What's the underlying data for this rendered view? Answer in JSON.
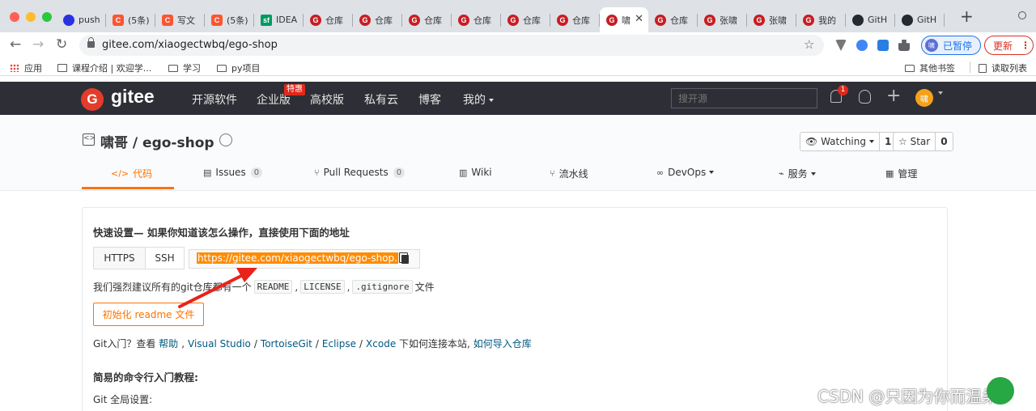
{
  "browser": {
    "tabs": [
      {
        "label": "push",
        "icon": "baidu"
      },
      {
        "label": "(5条)",
        "icon": "csdn"
      },
      {
        "label": "写文",
        "icon": "csdn"
      },
      {
        "label": "(5条)",
        "icon": "csdn"
      },
      {
        "label": "IDEA",
        "icon": "sf"
      },
      {
        "label": "仓库",
        "icon": "gitee"
      },
      {
        "label": "仓库",
        "icon": "gitee"
      },
      {
        "label": "仓库",
        "icon": "gitee"
      },
      {
        "label": "仓库",
        "icon": "gitee"
      },
      {
        "label": "仓库",
        "icon": "gitee"
      },
      {
        "label": "仓库",
        "icon": "gitee"
      },
      {
        "label": "啸",
        "icon": "gitee",
        "active": true
      },
      {
        "label": "仓库",
        "icon": "gitee"
      },
      {
        "label": "张啸",
        "icon": "gitee"
      },
      {
        "label": "张啸",
        "icon": "gitee"
      },
      {
        "label": "我的",
        "icon": "gitee"
      },
      {
        "label": "GitH",
        "icon": "github"
      },
      {
        "label": "GitH",
        "icon": "github"
      }
    ],
    "fav_text": {
      "gitee": "G",
      "csdn": "C",
      "sf": "sf",
      "baidu": "",
      "github": ""
    },
    "close_glyph": "✕",
    "newtab_glyph": "+",
    "url": "gitee.com/xiaogectwbq/ego-shop",
    "profile_label": "已暂停",
    "profile_avatar": "啸",
    "update_label": "更新",
    "update_menu": "⋮",
    "bookmarks": {
      "apps": "应用",
      "course": "课程介绍 | 欢迎学...",
      "study": "学习",
      "py": "py项目",
      "other": "其他书签",
      "reading": "读取列表"
    },
    "colors": {
      "tabstrip": "#dee1e6",
      "close": "#ff5f57",
      "min": "#febc2e",
      "max": "#28c840"
    }
  },
  "gitee": {
    "logo_letter": "G",
    "brand": "gitee",
    "nav": [
      "开源软件",
      "企业版",
      "高校版",
      "私有云",
      "博客",
      "我的"
    ],
    "hot_badge": "特惠",
    "search_placeholder": "搜开源",
    "notif_count": "1",
    "user_avatar": "啸",
    "colors": {
      "header": "#2e2f36",
      "accent": "#fe7300",
      "logo": "#e43c2b"
    }
  },
  "repo": {
    "title": "啸哥 / ego-shop",
    "watch_label": "Watching",
    "watch_count": "1",
    "star_label": "Star",
    "star_count": "0",
    "tabs": {
      "code": "代码",
      "issues": "Issues",
      "issues_count": "0",
      "pr": "Pull Requests",
      "pr_count": "0",
      "wiki": "Wiki",
      "pipeline": "流水线",
      "devops": "DevOps",
      "service": "服务",
      "manage": "管理"
    }
  },
  "quick_setup": {
    "title": "快速设置— 如果你知道该怎么操作，直接使用下面的地址",
    "https_label": "HTTPS",
    "ssh_label": "SSH",
    "clone_url": "https://gitee.com/xiaogectwbq/ego-shop.",
    "recommend_prefix": "我们强烈建议所有的git仓库都有一个",
    "readme": "README",
    "license": "LICENSE",
    "gitignore": ".gitignore",
    "recommend_suffix": "文件",
    "init_button": "初始化 readme 文件",
    "intro_prefix": "Git入门？查看",
    "help_link": "帮助",
    "vs_link": "Visual Studio",
    "tortoise_link": "TortoiseGit",
    "eclipse_link": "Eclipse",
    "xcode_link": "Xcode",
    "intro_mid": "下如何连接本站,",
    "import_link": "如何导入仓库",
    "cmd_heading": "简易的命令行入门教程:",
    "global_settings": "Git 全局设置:"
  },
  "watermark": "CSDN @只因为你而温柔"
}
